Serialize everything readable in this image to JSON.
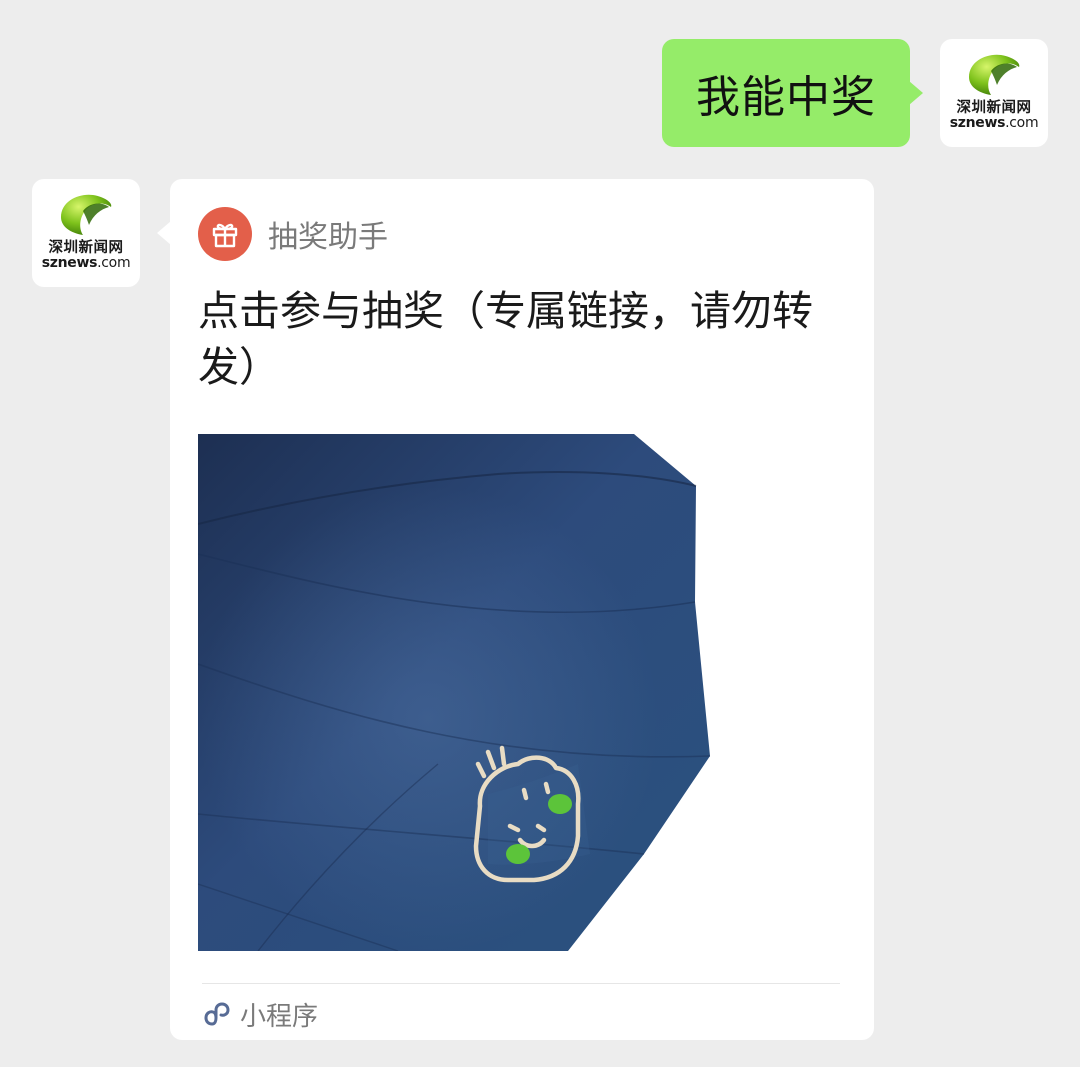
{
  "outgoing": {
    "text": "我能中奖",
    "avatar": {
      "name_cn": "深圳新闻网",
      "name_en_prefix": "sznews",
      "name_en_suffix": ".com"
    }
  },
  "incoming": {
    "avatar": {
      "name_cn": "深圳新闻网",
      "name_en_prefix": "sznews",
      "name_en_suffix": ".com"
    },
    "card": {
      "source_icon": "gift-icon",
      "source_name": "抽奖助手",
      "title": "点击参与抽奖（专属链接，请勿转发）",
      "image_description_icon": "umbrella-photo",
      "footer_icon": "mini-program-icon",
      "footer_label": "小程序"
    }
  },
  "colors": {
    "background": "#ededed",
    "outgoing_bubble": "#95ec69",
    "card": "#ffffff",
    "gift_badge": "#e35f4a",
    "umbrella": "#2b4a78",
    "mini_program_icon": "#576b95"
  }
}
